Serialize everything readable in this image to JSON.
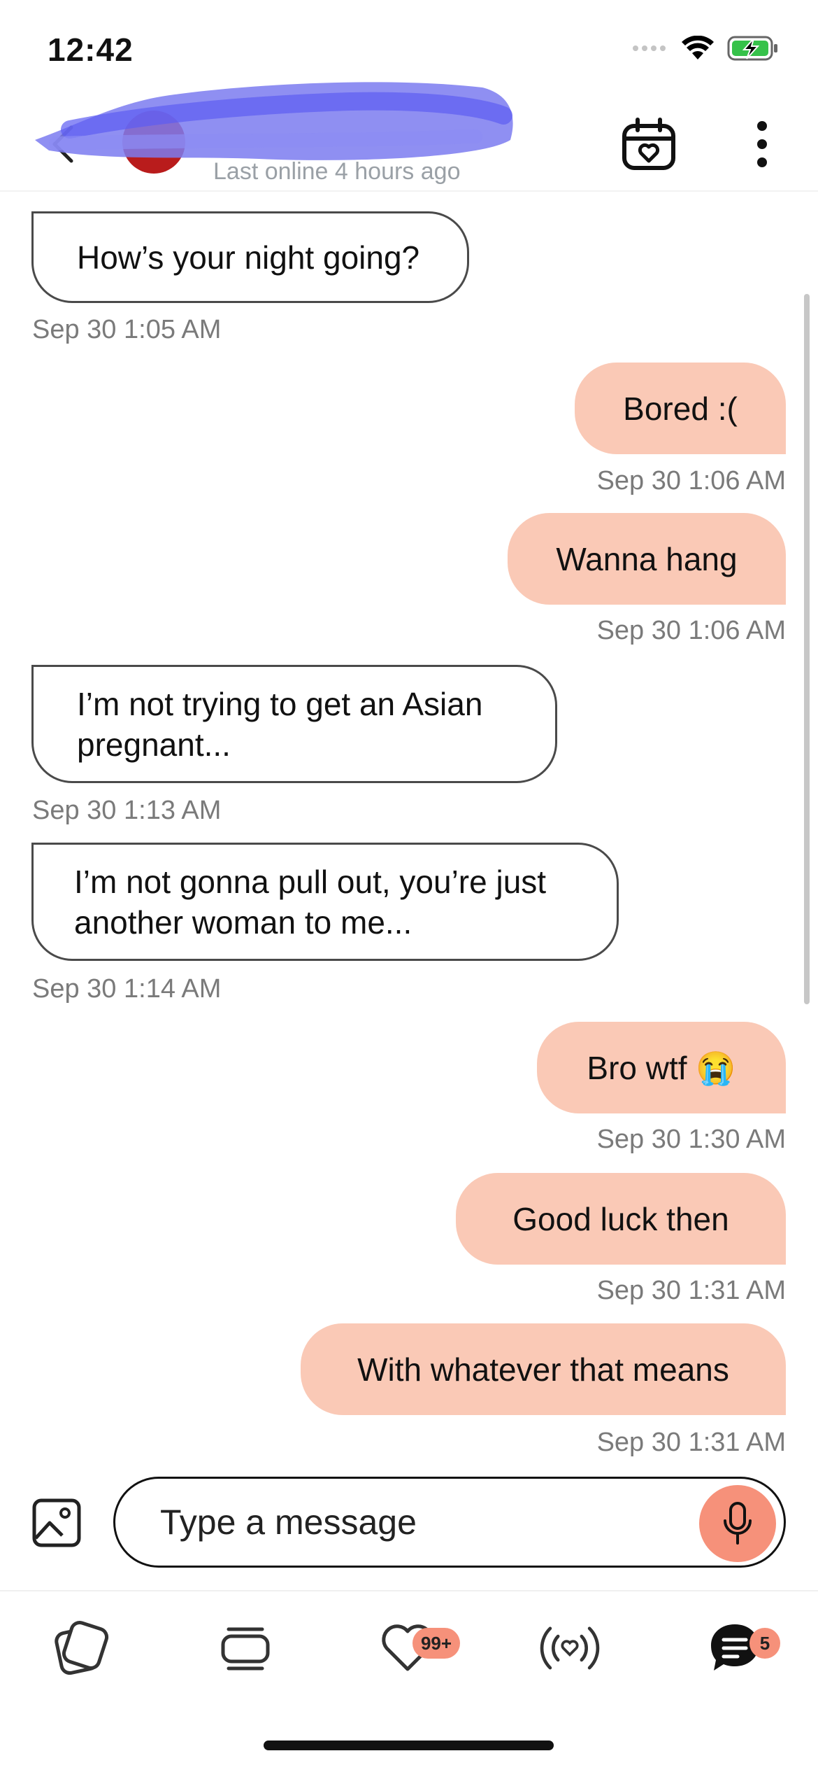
{
  "status_bar": {
    "time": "12:42"
  },
  "header": {
    "contact_name": "",
    "last_online": "Last online 4 hours ago"
  },
  "messages": [
    {
      "side": "in",
      "text": "How’s your night going?",
      "time": "Sep 30 1:05 AM"
    },
    {
      "side": "out",
      "text": "Bored :(",
      "time": "Sep 30 1:06 AM"
    },
    {
      "side": "out",
      "text": "Wanna hang",
      "time": "Sep 30 1:06 AM"
    },
    {
      "side": "in",
      "text": "I’m not trying to get an Asian pregnant...",
      "time": "Sep 30 1:13 AM"
    },
    {
      "side": "in",
      "text": "I’m not gonna pull out, you’re just another woman to me...",
      "time": "Sep 30 1:14 AM"
    },
    {
      "side": "out",
      "text": "Bro wtf 😭",
      "time": "Sep 30 1:30 AM"
    },
    {
      "side": "out",
      "text": "Good luck then",
      "time": "Sep 30 1:31 AM"
    },
    {
      "side": "out",
      "text": "With whatever that means",
      "time": "Sep 30 1:31 AM"
    }
  ],
  "composer": {
    "placeholder": "Type a message"
  },
  "tabbar": {
    "likes_badge": "99+",
    "messages_badge": "5"
  },
  "colors": {
    "outgoing_bubble": "#fac9b6",
    "accent": "#f6917a",
    "incoming_border": "#4a4a4a",
    "timestamp": "#7a7a7a"
  }
}
